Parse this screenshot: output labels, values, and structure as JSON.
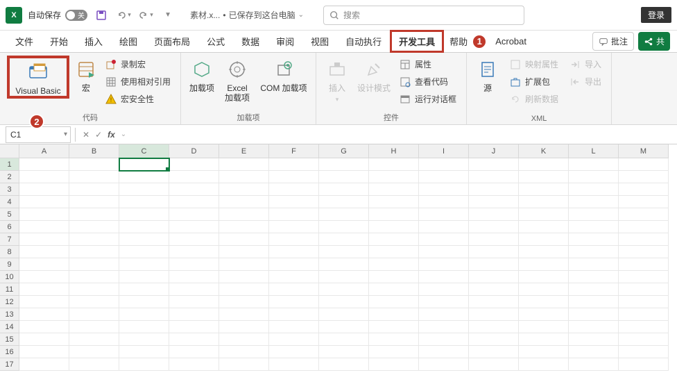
{
  "titlebar": {
    "autosave_label": "自动保存",
    "autosave_state": "关",
    "doc_name": "素材.x...",
    "saved_text": "已保存到这台电脑",
    "search_placeholder": "搜索",
    "login": "登录"
  },
  "tabs": {
    "items": [
      "文件",
      "开始",
      "插入",
      "绘图",
      "页面布局",
      "公式",
      "数据",
      "审阅",
      "视图",
      "自动执行",
      "开发工具",
      "帮助",
      "Acrobat"
    ],
    "active_index": 10,
    "comments": "批注",
    "share": "共"
  },
  "callouts": {
    "tab": "1",
    "vb": "2"
  },
  "ribbon": {
    "code": {
      "visual_basic": "Visual Basic",
      "macros": "宏",
      "record_macro": "录制宏",
      "use_relative": "使用相对引用",
      "macro_security": "宏安全性",
      "group": "代码"
    },
    "addins": {
      "addins": "加载项",
      "excel_addins": "Excel\n加载项",
      "com_addins": "COM 加载项",
      "group": "加载项"
    },
    "controls": {
      "insert": "插入",
      "design_mode": "设计模式",
      "properties": "属性",
      "view_code": "查看代码",
      "run_dialog": "运行对话框",
      "group": "控件"
    },
    "xml": {
      "source": "源",
      "map_props": "映射属性",
      "expansion": "扩展包",
      "refresh": "刷新数据",
      "import": "导入",
      "export": "导出",
      "group": "XML"
    }
  },
  "formula_bar": {
    "name": "C1"
  },
  "grid": {
    "columns": [
      "A",
      "B",
      "C",
      "D",
      "E",
      "F",
      "G",
      "H",
      "I",
      "J",
      "K",
      "L",
      "M"
    ],
    "rows": [
      "1",
      "2",
      "3",
      "4",
      "5",
      "6",
      "7",
      "8",
      "9",
      "10",
      "11",
      "12",
      "13",
      "14",
      "15",
      "16",
      "17"
    ],
    "active_col": 2,
    "active_row": 0
  }
}
